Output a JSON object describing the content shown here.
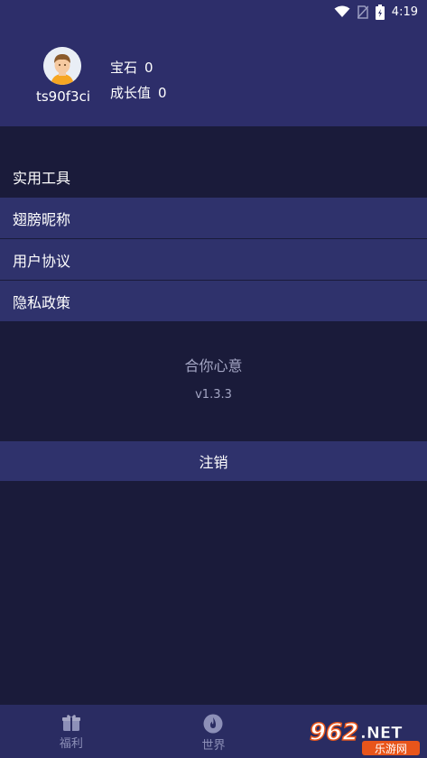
{
  "status_bar": {
    "time": "4:19"
  },
  "profile": {
    "username": "ts90f3ci",
    "gems_label": "宝石",
    "gems_value": "0",
    "growth_label": "成长值",
    "growth_value": "0"
  },
  "menu": {
    "items": [
      {
        "label": "实用工具"
      },
      {
        "label": "翅膀昵称"
      },
      {
        "label": "用户协议"
      },
      {
        "label": "隐私政策"
      }
    ]
  },
  "about": {
    "app_name": "合你心意",
    "version": "v1.3.3"
  },
  "logout_label": "注销",
  "tabs": [
    {
      "label": "福利",
      "icon": "gift-icon"
    },
    {
      "label": "世界",
      "icon": "fire-icon"
    }
  ],
  "watermark": {
    "number": "962",
    "suffix": ".NET",
    "site": "乐游网"
  },
  "colors": {
    "header_bg": "#2d2e6a",
    "page_bg": "#1a1b3a",
    "row_bg": "#2f326c",
    "muted_text": "#a4a6c4",
    "tab_text": "#8d90b8"
  }
}
